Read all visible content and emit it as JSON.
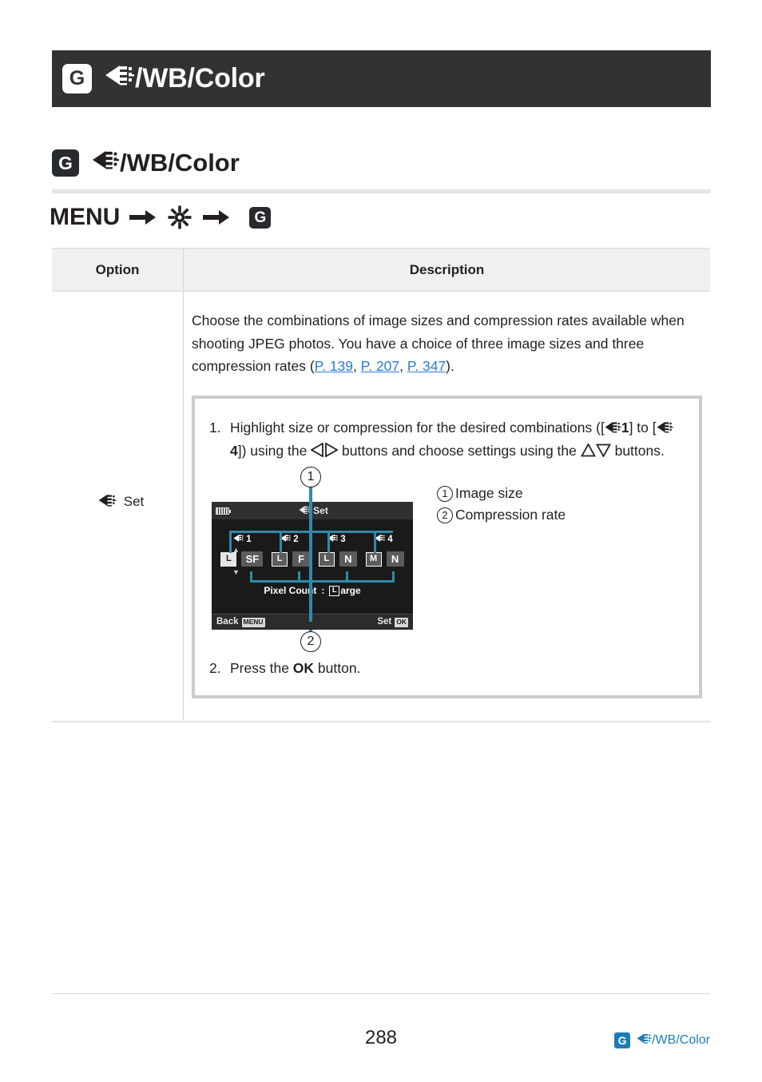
{
  "header": {
    "badge": "G",
    "icon": "image-quality-icon",
    "title": "/WB/Color"
  },
  "section": {
    "badge": "G",
    "icon": "image-quality-icon",
    "title": "/WB/Color"
  },
  "menu_path": {
    "label": "MENU",
    "arrow1": "arrow-right-icon",
    "gear": "setup-gear-icon",
    "arrow2": "arrow-right-icon",
    "badge": "G"
  },
  "table": {
    "headers": {
      "option": "Option",
      "description": "Description"
    },
    "row": {
      "option_icon": "image-quality-icon",
      "option_label": "Set",
      "description": {
        "paragraph_1": "Choose the combinations of image sizes and compression rates available when shooting JPEG photos. You have a choice of three image sizes and three compression rates (",
        "link_1": "P. 139",
        "sep_1": ", ",
        "link_2": "P. 207",
        "sep_2": ", ",
        "link_3": "P. 347",
        "paragraph_1_end": ")."
      }
    }
  },
  "procedure": {
    "step1": {
      "number": "1.",
      "text_a": "Highlight size or compression for the desired combinations ([",
      "bracket_1_label": "1",
      "text_b": "] to [",
      "bracket_4_label": "4",
      "text_c": "]) using the ",
      "text_d": " buttons and choose settings using the ",
      "text_e": " buttons.",
      "left_icon": "triangle-left-icon",
      "right_icon": "triangle-right-icon",
      "up_icon": "triangle-up-icon",
      "down_icon": "triangle-down-icon"
    },
    "step2": {
      "number": "2.",
      "text_a": "Press the ",
      "ok_label": "OK",
      "text_b": " button."
    }
  },
  "figure": {
    "marker_top": "1",
    "marker_bottom": "2",
    "callouts": [
      {
        "num": "1",
        "label": "Image size"
      },
      {
        "num": "2",
        "label": "Compression rate"
      }
    ],
    "lcd": {
      "battery_icon": "battery-icon",
      "title_icon": "image-quality-icon",
      "title": "Set",
      "slots": [
        {
          "quality_label": "1",
          "size": "L",
          "size_selected": true,
          "compression": "SF"
        },
        {
          "quality_label": "2",
          "size": "L",
          "size_selected": false,
          "compression": "F"
        },
        {
          "quality_label": "3",
          "size": "L",
          "size_selected": false,
          "compression": "N"
        },
        {
          "quality_label": "4",
          "size": "M",
          "size_selected": false,
          "compression": "N"
        }
      ],
      "pixel_count_label": "Pixel Count",
      "pixel_count_sep": ":",
      "pixel_count_box": "L",
      "pixel_count_value": "arge",
      "back_label": "Back",
      "back_key": "MENU",
      "set_label": "Set",
      "set_key": "OK"
    }
  },
  "footer": {
    "page_number": "288",
    "badge": "G",
    "icon": "image-quality-icon",
    "link_text": "/WB/Color"
  },
  "colors": {
    "header_bar": "#323232",
    "link_blue": "#2a7ade",
    "footer_blue": "#1a7fb5",
    "connector_teal": "#2b8caa",
    "rule_gray": "#e2e4e6"
  }
}
